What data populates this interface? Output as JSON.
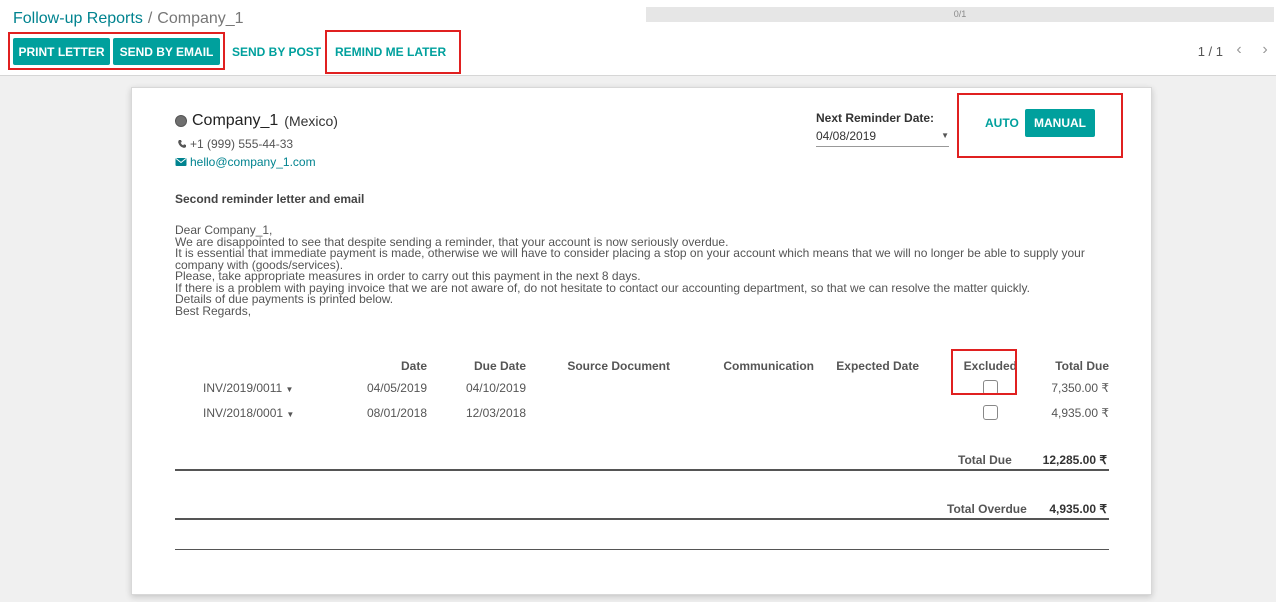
{
  "breadcrumb": {
    "parent": "Follow-up Reports",
    "separator": "/",
    "current": "Company_1"
  },
  "progress": {
    "label": "0/1",
    "fraction": 0
  },
  "toolbar": {
    "print_letter": "PRINT LETTER",
    "send_by_email": "SEND BY EMAIL",
    "send_by_post": "SEND BY POST",
    "remind_me_later": "REMIND ME LATER"
  },
  "pager": {
    "value": "1 / 1",
    "prev_icon": "‹",
    "next_icon": "›"
  },
  "partner": {
    "name": "Company_1",
    "country": "(Mexico)",
    "phone": "+1 (999) 555-44-33",
    "email": "hello@company_1.com"
  },
  "reminder": {
    "label": "Next Reminder Date:",
    "date": "04/08/2019"
  },
  "mode": {
    "auto": "AUTO",
    "manual": "MANUAL"
  },
  "followup_level": "Second reminder letter and email",
  "letter_lines": [
    "Dear Company_1,",
    "We are disappointed to see that despite sending a reminder, that your account is now seriously overdue.",
    "It is essential that immediate payment is made, otherwise we will have to consider placing a stop on your account which means that we will no longer be able to supply your",
    "company with (goods/services).",
    "Please, take appropriate measures in order to carry out this payment in the next 8 days.",
    "If there is a problem with paying invoice that we are not aware of, do not hesitate to contact our accounting department, so that we can resolve the matter quickly.",
    "Details of due payments is printed below.",
    "Best Regards,"
  ],
  "table": {
    "headers": {
      "date": "Date",
      "due_date": "Due Date",
      "source": "Source Document",
      "communication": "Communication",
      "expected": "Expected Date",
      "excluded": "Excluded",
      "total_due": "Total Due"
    },
    "rows": [
      {
        "invoice": "INV/2019/0011",
        "date": "04/05/2019",
        "due_date": "04/10/2019",
        "source": "",
        "communication": "",
        "expected": "",
        "total": "7,350.00 ₹"
      },
      {
        "invoice": "INV/2018/0001",
        "date": "08/01/2018",
        "due_date": "12/03/2018",
        "source": "",
        "communication": "",
        "expected": "",
        "total": "4,935.00 ₹"
      }
    ]
  },
  "totals": {
    "total_due_label": "Total Due",
    "total_due": "12,285.00 ₹",
    "total_overdue_label": "Total Overdue",
    "total_overdue": "4,935.00 ₹"
  },
  "colors": {
    "accent": "#00a09d",
    "link": "#00838f",
    "overdue": "#d0021b",
    "highlight": "#e02020"
  }
}
